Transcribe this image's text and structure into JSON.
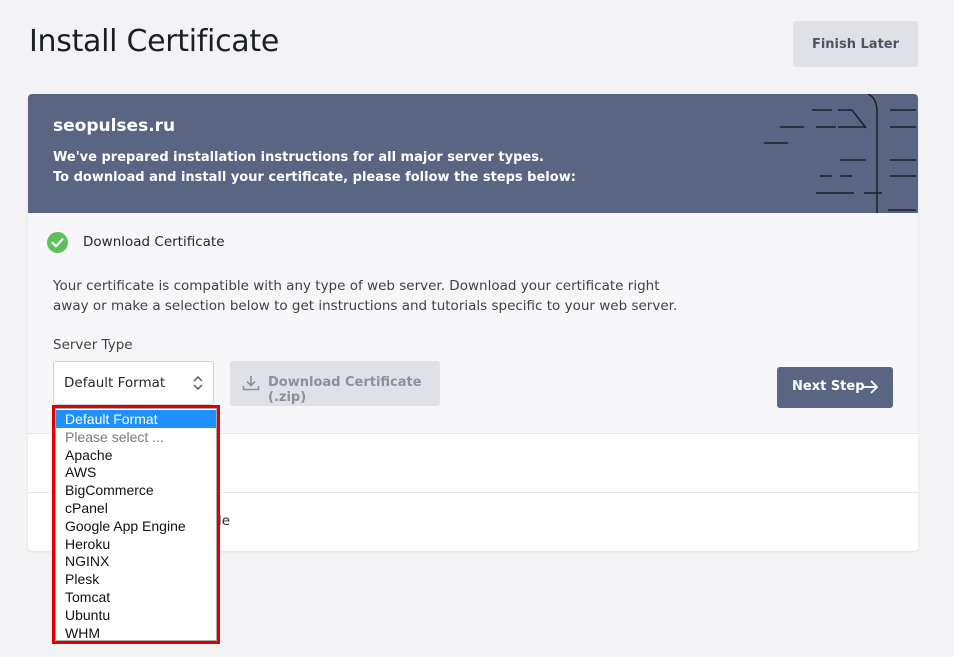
{
  "header": {
    "title": "Install Certificate",
    "finish_later": "Finish Later"
  },
  "banner": {
    "domain": "seopulses.ru",
    "line1": "We've prepared installation instructions for all major server types.",
    "line2": "To download and install your certificate, please follow the steps below:"
  },
  "step1": {
    "title": "Download Certificate",
    "description": "Your certificate is compatible with any type of web server. Download your certificate right away or make a selection below to get instructions and tutorials specific to your web server.",
    "server_type_label": "Server Type",
    "selected_value": "Default Format",
    "download_label": "Download Certificate (.zip)",
    "next_label": "Next Step"
  },
  "step3": {
    "title_fragment": "le"
  },
  "dropdown": {
    "options": [
      "Default Format",
      "Please select ...",
      "Apache",
      "AWS",
      "BigCommerce",
      "cPanel",
      "Google App Engine",
      "Heroku",
      "NGINX",
      "Plesk",
      "Tomcat",
      "Ubuntu",
      "WHM"
    ],
    "selected_index": 0,
    "placeholder_index": 1
  },
  "colors": {
    "banner": "#5a6584",
    "check": "#5cc15a",
    "highlight": "#e00000",
    "selected_option": "#1e90ff"
  }
}
